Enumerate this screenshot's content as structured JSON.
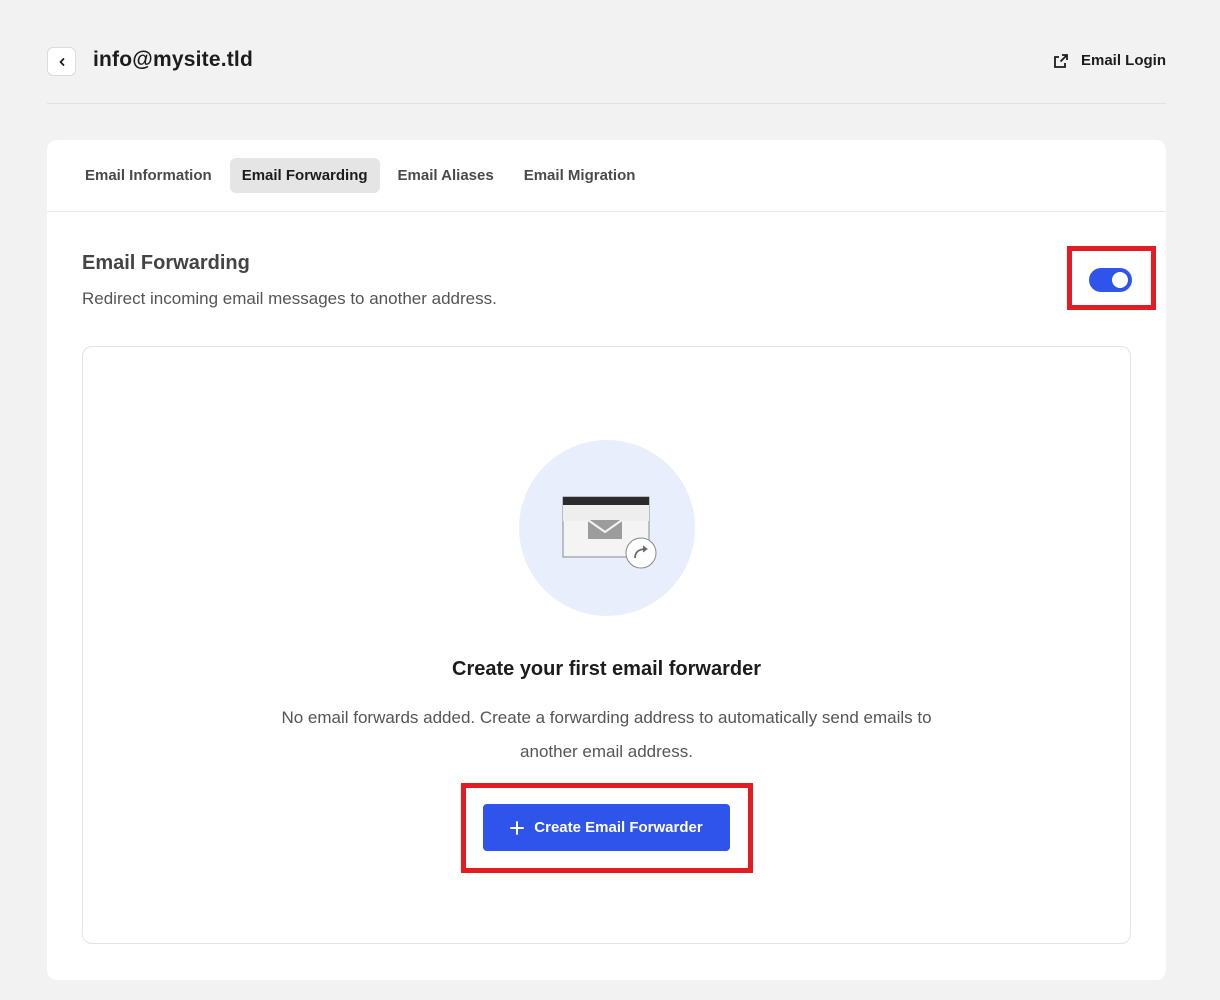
{
  "header": {
    "title": "info@mysite.tld",
    "email_login_label": "Email Login"
  },
  "tabs": [
    {
      "label": "Email Information",
      "active": false
    },
    {
      "label": "Email Forwarding",
      "active": true
    },
    {
      "label": "Email Aliases",
      "active": false
    },
    {
      "label": "Email Migration",
      "active": false
    }
  ],
  "section": {
    "title": "Email Forwarding",
    "description": "Redirect incoming email messages to another address.",
    "toggle_on": true
  },
  "empty_state": {
    "title": "Create your first email forwarder",
    "description": "No email forwards added. Create a forwarding address to automatically send emails to another email address.",
    "button_label": "Create Email Forwarder"
  },
  "colors": {
    "accent": "#2f54eb",
    "highlight": "#e31b23",
    "illustration_bg": "#e8eefb"
  }
}
